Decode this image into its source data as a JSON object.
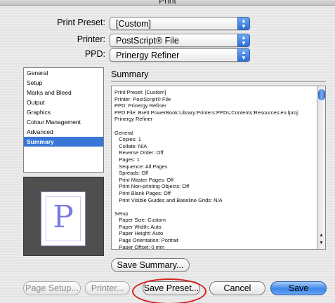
{
  "window": {
    "title": "Print"
  },
  "settings": {
    "preset_label": "Print Preset:",
    "preset_value": "[Custom]",
    "printer_label": "Printer:",
    "printer_value": "PostScript® File",
    "ppd_label": "PPD:",
    "ppd_value": "Prinergy Refiner"
  },
  "categories": [
    {
      "label": "General",
      "selected": false
    },
    {
      "label": "Setup",
      "selected": false
    },
    {
      "label": "Marks and Bleed",
      "selected": false
    },
    {
      "label": "Output",
      "selected": false
    },
    {
      "label": "Graphics",
      "selected": false
    },
    {
      "label": "Colour Management",
      "selected": false
    },
    {
      "label": "Advanced",
      "selected": false
    },
    {
      "label": "Summary",
      "selected": true
    }
  ],
  "preview": {
    "letter": "P"
  },
  "summary": {
    "title": "Summary",
    "lines": [
      "Print Preset: [Custom]",
      "Printer: PostScript® File",
      "PPD: Prinergy Refiner",
      "PPD File: Brett PowerBook:Library:Printers:PPDs:Contents:Resources:en.lproj:",
      "Prinergy Refiner",
      "",
      "General",
      "   Copies: 1",
      "   Collate: N/A",
      "   Reverse Order: Off",
      "   Pages: 1",
      "   Sequence: All Pages",
      "   Spreads: Off",
      "   Print Master Pages: Off",
      "   Print Non-printing Objects: Off",
      "   Print Blank Pages: Off",
      "   Print Visible Guides and Baseline Grids: N/A",
      "",
      "Setup",
      "   Paper Size: Custom",
      "   Paper Width: Auto",
      "   Paper Height: Auto",
      "   Page Orientation: Portrait",
      "   Paper Offset: 0 mm"
    ],
    "save_summary_label": "Save Summary..."
  },
  "buttons": {
    "page_setup": "Page Setup...",
    "printer": "Printer...",
    "save_preset": "Save Preset...",
    "cancel": "Cancel",
    "save": "Save"
  },
  "colors": {
    "selection": "#3875d7",
    "default_button": "#3c86e9",
    "annotation": "#d92020"
  }
}
